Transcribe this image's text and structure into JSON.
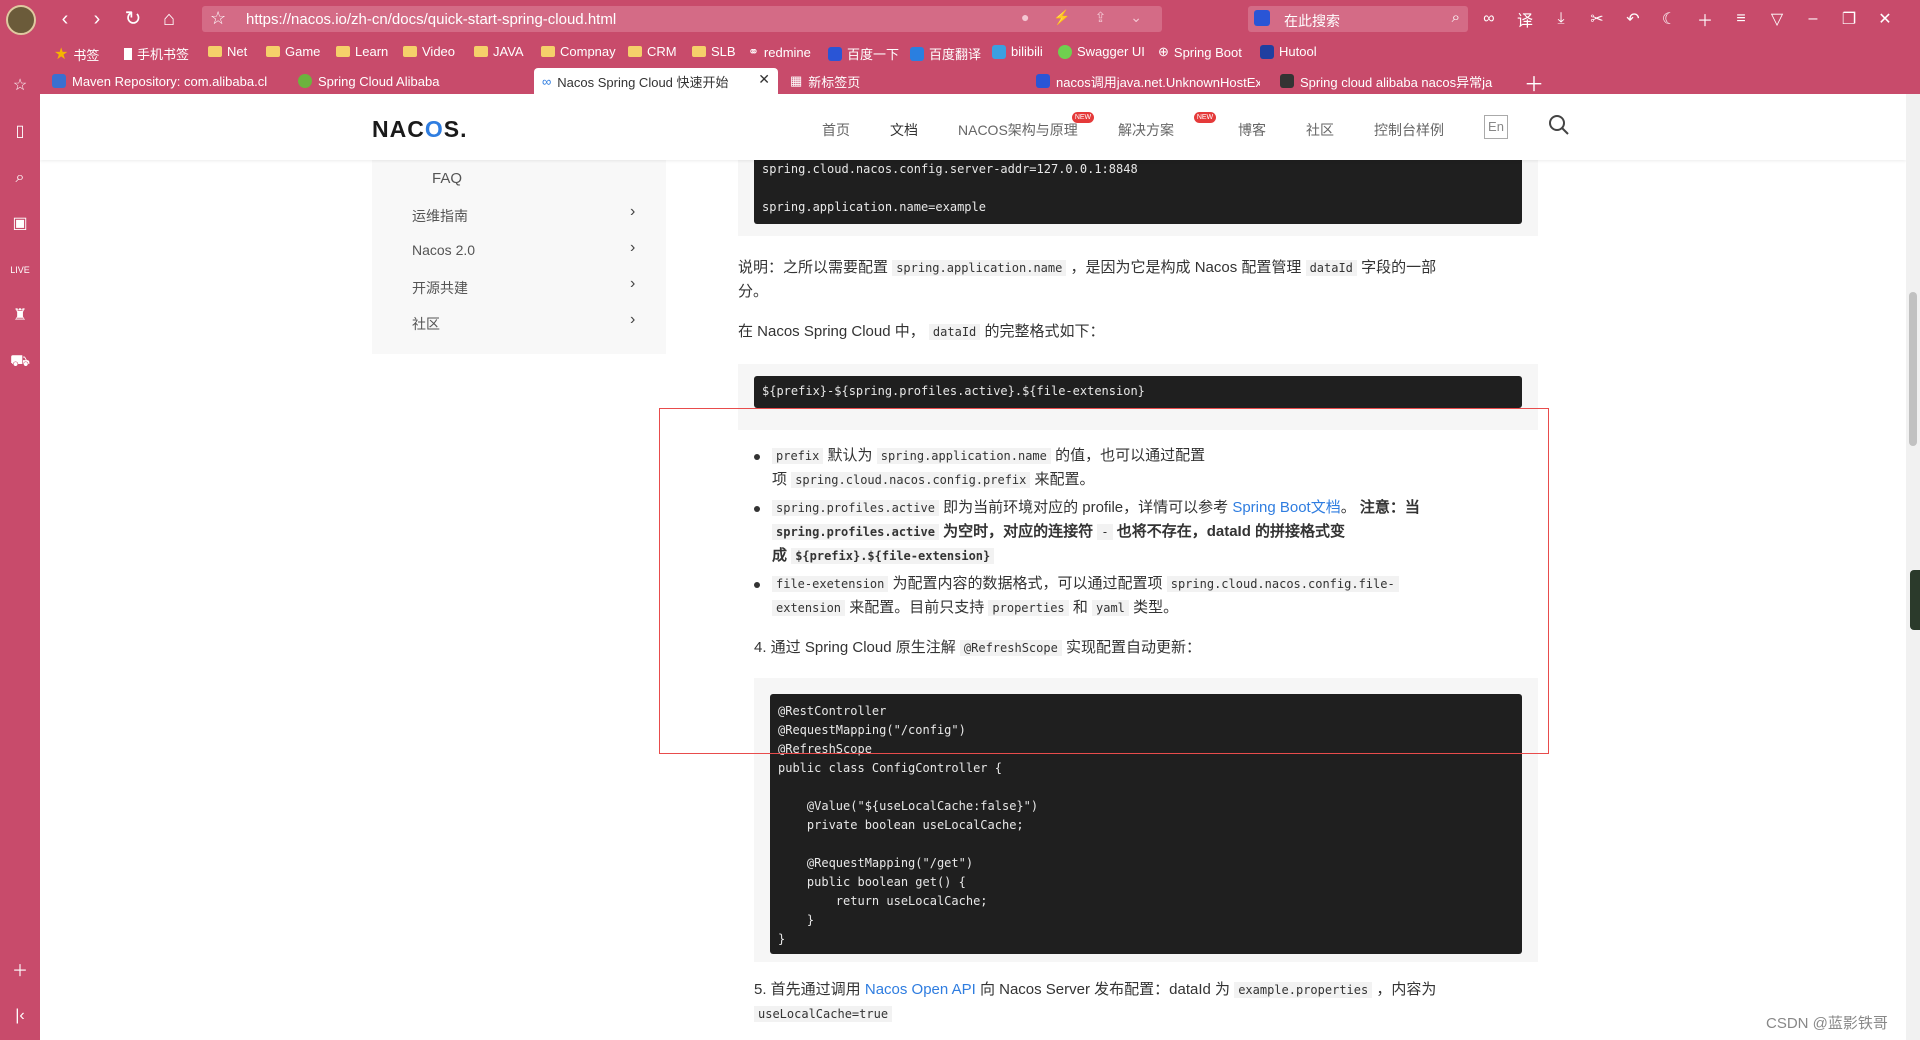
{
  "browser": {
    "url": "https://nacos.io/zh-cn/docs/quick-start-spring-cloud.html",
    "search_placeholder": "在此搜索",
    "bookmarks": [
      "书签",
      "手机书签",
      "Net",
      "Game",
      "Learn",
      "Video",
      "JAVA",
      "Compnay",
      "CRM",
      "SLB",
      "redmine",
      "百度一下",
      "百度翻译",
      "bilibili",
      "Swagger UI",
      "Spring Boot",
      "Hutool"
    ],
    "tabs": [
      {
        "label": "Maven Repository: com.alibaba.cl"
      },
      {
        "label": "Spring Cloud Alibaba"
      },
      {
        "label": "Nacos Spring Cloud 快速开始"
      },
      {
        "label": "新标签页"
      },
      {
        "label": "nacos调用java.net.UnknownHostEx"
      },
      {
        "label": "Spring cloud alibaba nacos异常ja"
      }
    ]
  },
  "site": {
    "logo": "NACOS.",
    "nav": [
      "首页",
      "文档",
      "NACOS架构与原理",
      "解决方案",
      "博客",
      "社区",
      "控制台样例"
    ],
    "new_badge": "NEW",
    "lang": "En"
  },
  "sidebar": {
    "faq": "FAQ",
    "items": [
      "运维指南",
      "Nacos 2.0",
      "开源共建",
      "社区"
    ]
  },
  "article": {
    "code1": [
      "spring.cloud.nacos.config.server-addr=127.0.0.1:8848",
      "",
      "spring.application.name=example"
    ],
    "note_prefix": "说明：之所以需要配置",
    "note_code": "spring.application.name",
    "note_mid": "，是因为它是构成 Nacos 配置管理",
    "note_code2": "dataId",
    "note_suffix": "字段的一部",
    "note_suffix2": "分。",
    "format_prefix": "在 Nacos Spring Cloud 中，",
    "format_code": "dataId",
    "format_suffix": "的完整格式如下：",
    "code2": "${prefix}-${spring.profiles.active}.${file-extension}",
    "li1_code": "prefix",
    "li1_a": "默认为",
    "li1_code2": "spring.application.name",
    "li1_b": "的值，也可以通过配置",
    "li1_c": "项",
    "li1_code3": "spring.cloud.nacos.config.prefix",
    "li1_d": "来配置。",
    "li2_code": "spring.profiles.active",
    "li2_a": "即为当前环境对应的 profile，详情可以参考",
    "li2_link": "Spring Boot文档",
    "li2_b": "。",
    "li2_bold1": "注意：当",
    "li2_code2": "spring.profiles.active",
    "li2_bold2": "为空时，对应的连接符",
    "li2_code3": "-",
    "li2_bold3": "也将不存在，dataId 的拼接格式变",
    "li2_bold4": "成",
    "li2_code4": "${prefix}.${file-extension}",
    "li3_code": "file-exetension",
    "li3_a": "为配置内容的数据格式，可以通过配置项",
    "li3_code2": "spring.cloud.nacos.config.file-",
    "li3_code3": "extension",
    "li3_b": "来配置。目前只支持",
    "li3_code4": "properties",
    "li3_c": "和",
    "li3_code5": "yaml",
    "li3_d": "类型。",
    "step4_a": "4. 通过 Spring Cloud 原生注解",
    "step4_code": "@RefreshScope",
    "step4_b": "实现配置自动更新：",
    "code3": [
      "@RestController",
      "@RequestMapping(\"/config\")",
      "@RefreshScope",
      "public class ConfigController {",
      "",
      "    @Value(\"${useLocalCache:false}\")",
      "    private boolean useLocalCache;",
      "",
      "    @RequestMapping(\"/get\")",
      "    public boolean get() {",
      "        return useLocalCache;",
      "    }",
      "}"
    ],
    "step5_a": "5. 首先通过调用",
    "step5_link": "Nacos Open API",
    "step5_b": "向 Nacos Server 发布配置：dataId 为",
    "step5_code": "example.properties",
    "step5_c": "，内容为",
    "step5_code2": "useLocalCache=true"
  },
  "watermark": "CSDN @蓝影铁哥"
}
